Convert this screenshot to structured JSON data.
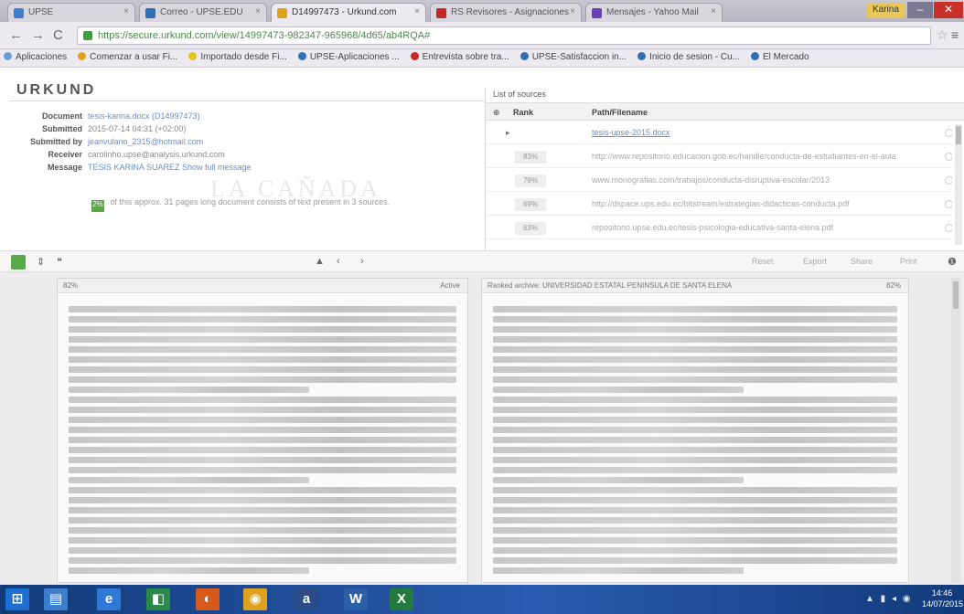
{
  "browser": {
    "tabs": [
      {
        "label": "UPSE",
        "active": false
      },
      {
        "label": "Correo - UPSE.EDU",
        "active": false
      },
      {
        "label": "D14997473 - Urkund.com",
        "active": true
      },
      {
        "label": "RS Revisores - Asignaciones",
        "active": false
      },
      {
        "label": "Mensajes - Yahoo Mail",
        "active": false
      }
    ],
    "user": "Karina",
    "url": "https://secure.urkund.com/view/14997473-982347-965968/4d65/ab4RQA#",
    "bookmarks": [
      {
        "label": "Aplicaciones",
        "color": "#6a9ed8"
      },
      {
        "label": "Comenzar a usar Fi...",
        "color": "#e0a21c"
      },
      {
        "label": "Importado desde Fi...",
        "color": "#e0c21c"
      },
      {
        "label": "UPSE-Aplicaciones ...",
        "color": "#2e6fb8"
      },
      {
        "label": "Entrevista sobre tra...",
        "color": "#c62828"
      },
      {
        "label": "UPSE-Satisfaccion in...",
        "color": "#2e6fb8"
      },
      {
        "label": "Inicio de sesion - Cu...",
        "color": "#2e6fb8"
      },
      {
        "label": "El Mercado",
        "color": "#2e6fb8"
      }
    ]
  },
  "urkund": {
    "logo": "URKUND",
    "meta": [
      {
        "key": "Document",
        "value": "tesis-karina.docx (D14997473)",
        "link": true
      },
      {
        "key": "Submitted",
        "value": "2015-07-14 04:31 (+02:00)",
        "link": false
      },
      {
        "key": "Submitted by",
        "value": "jeanvulano_2315@hotmail.com",
        "link": true
      },
      {
        "key": "Receiver",
        "value": "carolinho.upse@analysis.urkund.com",
        "link": false
      },
      {
        "key": "Message",
        "value": "TESIS KARINA SUAREZ Show full message",
        "link": true
      }
    ],
    "notice_pct": "2%",
    "notice_text": "of this approx. 31 pages long document consists of text present in 3 sources.",
    "watermark": "LA CAÑADA",
    "sources_title": "List of sources",
    "columns": [
      "Rank",
      "Path/Filename"
    ],
    "sources": [
      {
        "rank": "",
        "name": "tesis-upse-2015.docx",
        "link": true
      },
      {
        "rank": "83%",
        "name": "http://www.repositorio.educacion.gob.ec/handle/conducta-de-estudiantes-en-el-aula",
        "link": false
      },
      {
        "rank": "79%",
        "name": "www.monografias.com/trabajos/conducta-disruptiva-escolar/2013",
        "link": false
      },
      {
        "rank": "69%",
        "name": "http://dspace.ups.edu.ec/bitstream/estrategias-didacticas-conducta.pdf",
        "link": false
      },
      {
        "rank": "63%",
        "name": "repositorio.upse.edu.ec/tesis-psicologia-educativa-santa-elena.pdf",
        "link": false
      }
    ]
  },
  "compare": {
    "left_header": "82%",
    "left_header_right": "Active",
    "right_header": "Ranked archive: UNIVERSIDAD ESTATAL PENINSULA DE SANTA ELENA",
    "right_header_right": "82%",
    "tools": [
      "Reset",
      "Export",
      "Share",
      "Print"
    ]
  },
  "taskbar": {
    "apps": [
      {
        "glyph": "⊞",
        "color": "#1d6fd1"
      },
      {
        "glyph": "▤",
        "color": "#3c7fcf"
      },
      {
        "glyph": "e",
        "color": "#2f78d6"
      },
      {
        "glyph": "◧",
        "color": "#2a8a4a"
      },
      {
        "glyph": "◐",
        "color": "#d65a1a"
      },
      {
        "glyph": "◉",
        "color": "#e0a21c"
      },
      {
        "glyph": "a",
        "color": "#2b4b86"
      },
      {
        "glyph": "W",
        "color": "#2b5fa8"
      },
      {
        "glyph": "X",
        "color": "#237a3f"
      }
    ],
    "time": "14:46",
    "date": "14/07/2015"
  }
}
